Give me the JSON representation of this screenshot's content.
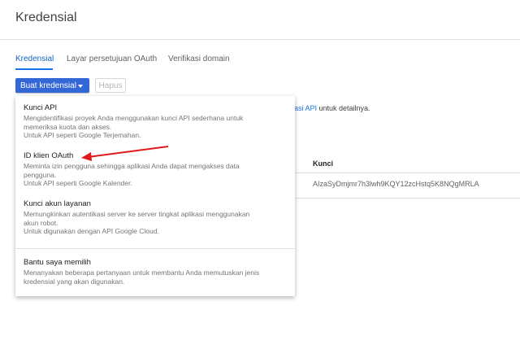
{
  "header": {
    "title": "Kredensial"
  },
  "tabs": [
    {
      "label": "Kredensial"
    },
    {
      "label": "Layar persetujuan OAuth"
    },
    {
      "label": "Verifikasi domain"
    }
  ],
  "toolbar": {
    "create_label": "Buat kredensial",
    "delete_label": "Hapus"
  },
  "background": {
    "link_text": "asi API",
    "info_suffix": " untuk detailnya.",
    "key_header": "Kunci",
    "api_key": "AIzaSyDmjmr7h3lwh9KQY12zcHstq5K8NQgMRLA"
  },
  "menu": {
    "items": [
      {
        "title": "Kunci API",
        "desc": [
          "Mengidentifikasi proyek Anda menggunakan kunci API sederhana untuk",
          "memeriksa kuota dan akses.",
          "Untuk API seperti Google Terjemahan."
        ]
      },
      {
        "title": "ID klien OAuth",
        "desc": [
          "Meminta izin pengguna sehingga aplikasi Anda dapat mengakses data",
          "pengguna.",
          "Untuk API seperti Google Kalender."
        ]
      },
      {
        "title": "Kunci akun layanan",
        "desc": [
          "Memungkinkan autentikasi server ke server tingkat aplikasi menggunakan",
          "akun robot.",
          "Untuk digunakan dengan API Google Cloud."
        ]
      },
      {
        "title": "Bantu saya memilih",
        "desc": [
          "Menanyakan beberapa pertanyaan untuk membantu Anda memutuskan jenis",
          "kredensial yang akan digunakan."
        ]
      }
    ]
  },
  "colors": {
    "accent": "#3367d6",
    "arrow": "#e01a1a"
  }
}
